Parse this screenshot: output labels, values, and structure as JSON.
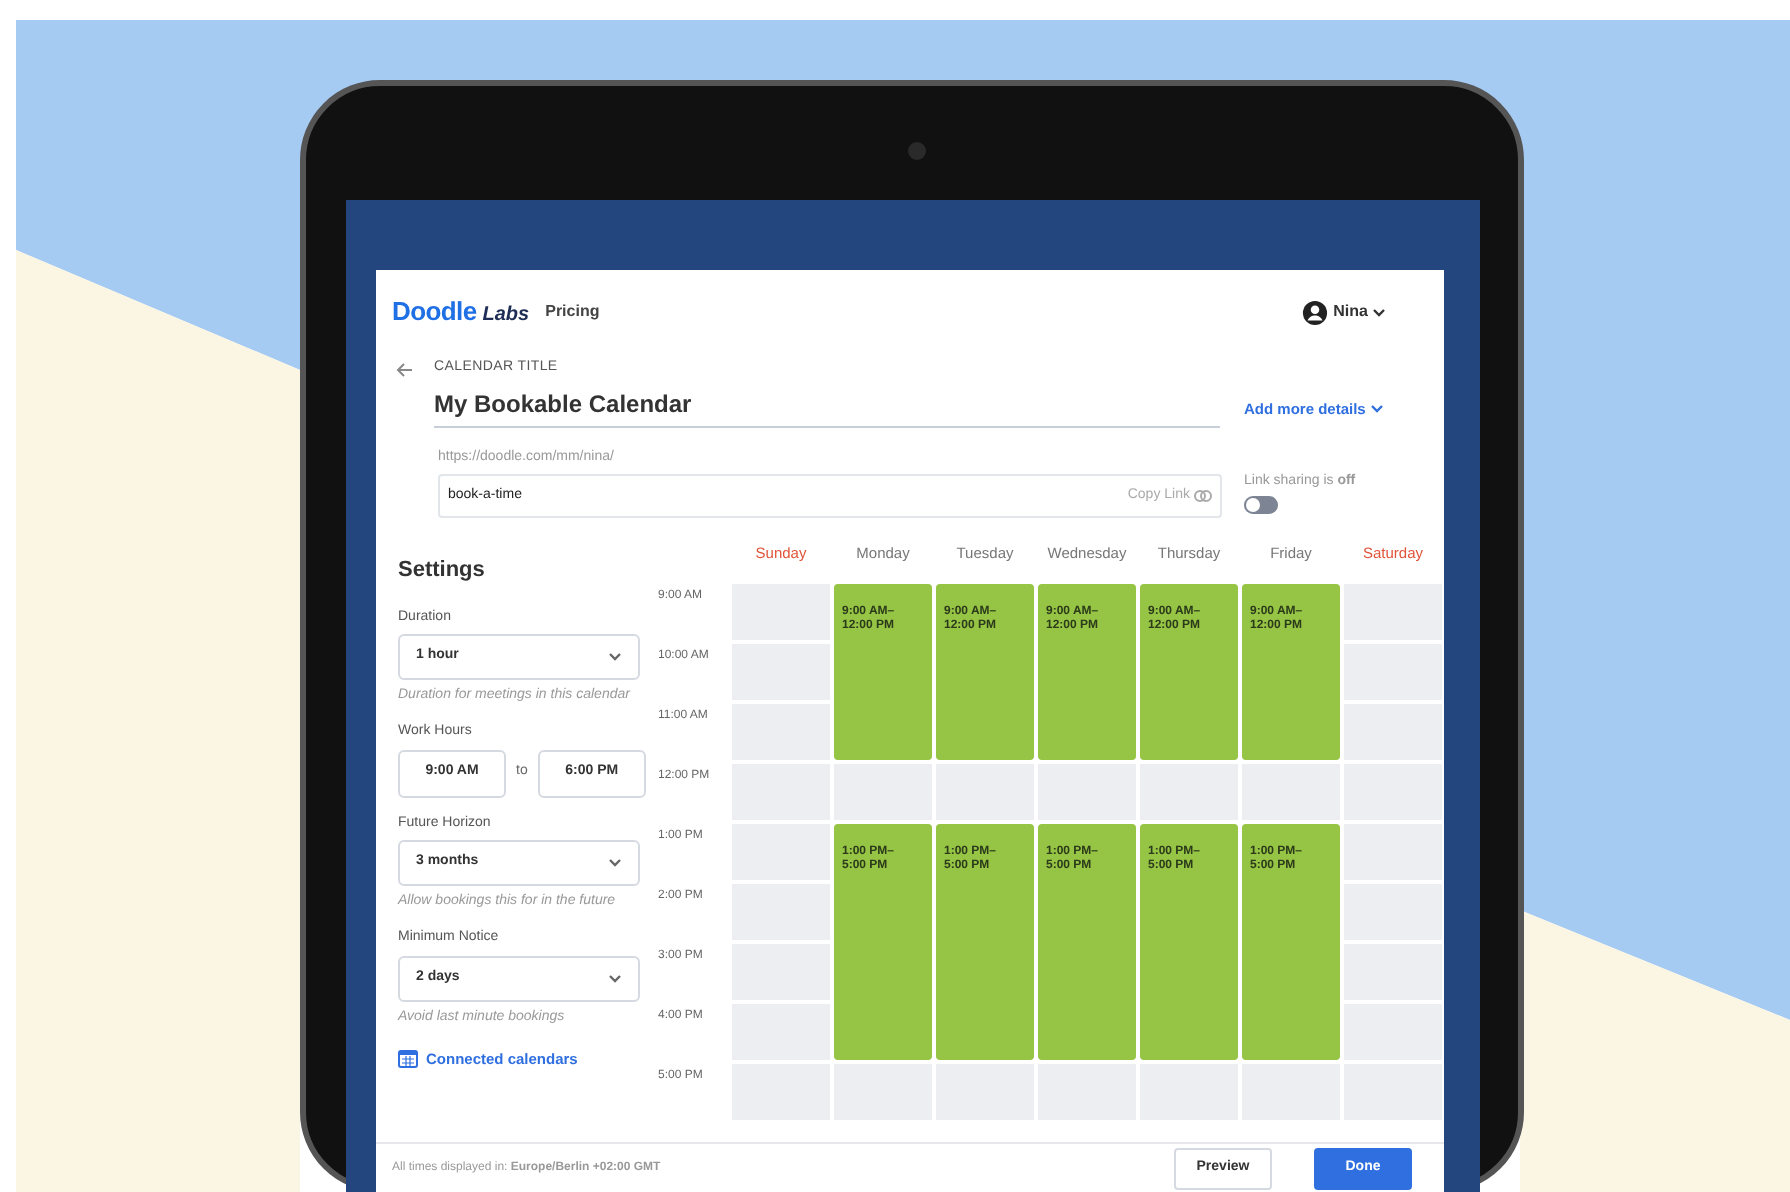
{
  "header": {
    "logo": {
      "brand": "Doodle",
      "suffix": "Labs"
    },
    "nav": [
      "Pricing"
    ],
    "user": "Nina"
  },
  "calendar_title": {
    "label": "CALENDAR TITLE",
    "value": "My Bookable Calendar",
    "more": "Add more details"
  },
  "link": {
    "prefix": "https://doodle.com/mm/nina/",
    "value": "book-a-time",
    "copy": "Copy Link",
    "sharing_text": "Link sharing is **off**",
    "sharing_on": false
  },
  "settings": {
    "title": "Settings",
    "fields": [
      {
        "kind": "select",
        "label": "Duration",
        "value": "1 hour",
        "hint": "Duration for meetings in this calendar"
      },
      {
        "kind": "range",
        "label": "Work Hours",
        "from": "9:00 AM",
        "joiner": "to",
        "to": "6:00 PM"
      },
      {
        "kind": "select",
        "label": "Future Horizon",
        "value": "3 months",
        "hint": "Allow bookings this for in the future"
      },
      {
        "kind": "select",
        "label": "Minimum Notice",
        "value": "2 days",
        "hint": "Avoid last minute bookings"
      }
    ],
    "connected": "Connected calendars"
  },
  "times": [
    "9:00 AM",
    "10:00 AM",
    "11:00 AM",
    "12:00 PM",
    "1:00 PM",
    "2:00 PM",
    "3:00 PM",
    "4:00 PM",
    "5:00 PM"
  ],
  "days": [
    {
      "name": "Sunday",
      "weekend": true,
      "hours": [
        {
          "available": false
        },
        {
          "available": false
        },
        {
          "available": false
        },
        {
          "available": false
        },
        {
          "available": false
        },
        {
          "available": false
        },
        {
          "available": false
        },
        {
          "available": false
        },
        {
          "available": false
        }
      ]
    },
    {
      "name": "Monday",
      "weekend": false,
      "hours": [
        {
          "available": true,
          "label": "9:00 AM–12:00 PM"
        },
        {
          "available": true
        },
        {
          "available": true
        },
        {
          "available": false
        },
        {
          "available": true,
          "label": "1:00 PM–5:00 PM"
        },
        {
          "available": true
        },
        {
          "available": true
        },
        {
          "available": true
        },
        {
          "available": false
        }
      ]
    },
    {
      "name": "Tuesday",
      "weekend": false,
      "hours": [
        {
          "available": true,
          "label": "9:00 AM–12:00 PM"
        },
        {
          "available": true
        },
        {
          "available": true
        },
        {
          "available": false
        },
        {
          "available": true,
          "label": "1:00 PM–5:00 PM"
        },
        {
          "available": true
        },
        {
          "available": true
        },
        {
          "available": true
        },
        {
          "available": false
        }
      ]
    },
    {
      "name": "Wednesday",
      "weekend": false,
      "hours": [
        {
          "available": true,
          "label": "9:00 AM–12:00 PM"
        },
        {
          "available": true
        },
        {
          "available": true
        },
        {
          "available": false
        },
        {
          "available": true,
          "label": "1:00 PM–5:00 PM"
        },
        {
          "available": true
        },
        {
          "available": true
        },
        {
          "available": true
        },
        {
          "available": false
        }
      ]
    },
    {
      "name": "Thursday",
      "weekend": false,
      "hours": [
        {
          "available": true,
          "label": "9:00 AM–12:00 PM"
        },
        {
          "available": true
        },
        {
          "available": true
        },
        {
          "available": false
        },
        {
          "available": true,
          "label": "1:00 PM–5:00 PM"
        },
        {
          "available": true
        },
        {
          "available": true
        },
        {
          "available": true
        },
        {
          "available": false
        }
      ]
    },
    {
      "name": "Friday",
      "weekend": false,
      "hours": [
        {
          "available": true,
          "label": "9:00 AM–12:00 PM"
        },
        {
          "available": true
        },
        {
          "available": true
        },
        {
          "available": false
        },
        {
          "available": true,
          "label": "1:00 PM–5:00 PM"
        },
        {
          "available": true
        },
        {
          "available": true
        },
        {
          "available": true
        },
        {
          "available": false
        }
      ]
    },
    {
      "name": "Saturday",
      "weekend": true,
      "hours": [
        {
          "available": false
        },
        {
          "available": false
        },
        {
          "available": false
        },
        {
          "available": false
        },
        {
          "available": false
        },
        {
          "available": false
        },
        {
          "available": false
        },
        {
          "available": false
        },
        {
          "available": false
        }
      ]
    }
  ],
  "footer": {
    "timezone": "All times displayed in: **Europe/Berlin +02:00 GMT**",
    "buttons": [
      {
        "label": "Preview",
        "primary": false
      },
      {
        "label": "Done",
        "primary": true
      }
    ]
  }
}
